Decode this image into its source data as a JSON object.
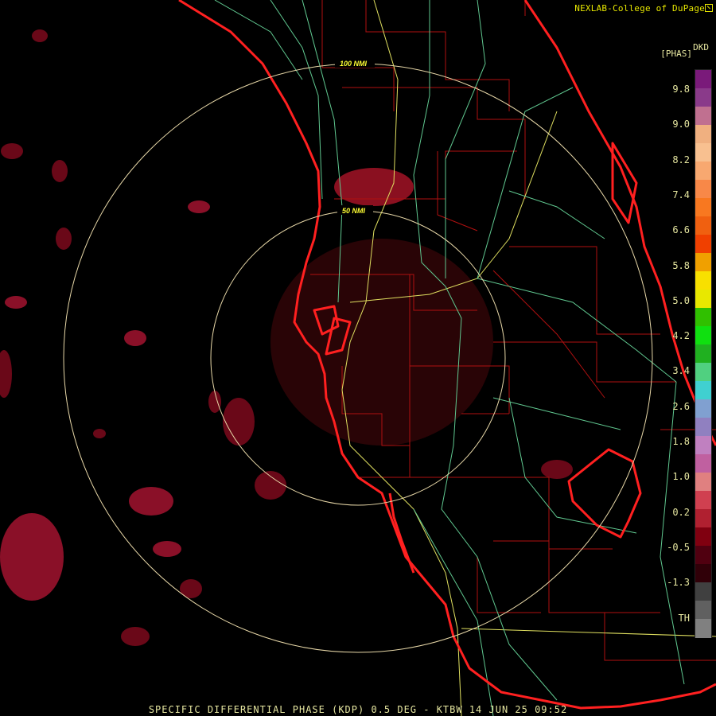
{
  "credit": "NEXLAB-College of DuPage",
  "footer": "SPECIFIC DIFFERENTIAL PHASE (KDP) 0.5 DEG - KTBW 14 JUN 25 09:52",
  "legend": {
    "product_code": "DKD",
    "unit": "[PHAS]",
    "ticks": [
      "9.8",
      "9.0",
      "8.2",
      "7.4",
      "6.6",
      "5.8",
      "5.0",
      "4.2",
      "3.4",
      "2.6",
      "1.8",
      "1.0",
      "0.2",
      "-0.5",
      "-1.3",
      "TH"
    ],
    "colors": [
      "#7a1a7a",
      "#8a3a8a",
      "#c07090",
      "#f0b080",
      "#f8c090",
      "#f8a870",
      "#f88848",
      "#f87820",
      "#f06010",
      "#f04000",
      "#f0a000",
      "#f8e000",
      "#e8e800",
      "#30c000",
      "#10e010",
      "#20b020",
      "#50d080",
      "#40d0d0",
      "#80a0d0",
      "#9080c0",
      "#c080c0",
      "#c060a0",
      "#e08080",
      "#d04050",
      "#b02030",
      "#800010",
      "#500010",
      "#300008",
      "#404040",
      "#606060",
      "#808080"
    ],
    "color_names": [
      "purple",
      "magenta",
      "peach",
      "orange",
      "red-orange",
      "yellow",
      "green",
      "cyan",
      "blue",
      "violet",
      "pink",
      "crimson",
      "maroon",
      "gray"
    ]
  },
  "range_rings": [
    {
      "label": "50 NMI"
    },
    {
      "label": "100 NMI"
    }
  ],
  "colors": {
    "coast": "#ff2020",
    "county": "#b01010",
    "highway_green": "#60c890",
    "highway_yellow": "#e0e060",
    "ring": "#e8d8a8"
  }
}
